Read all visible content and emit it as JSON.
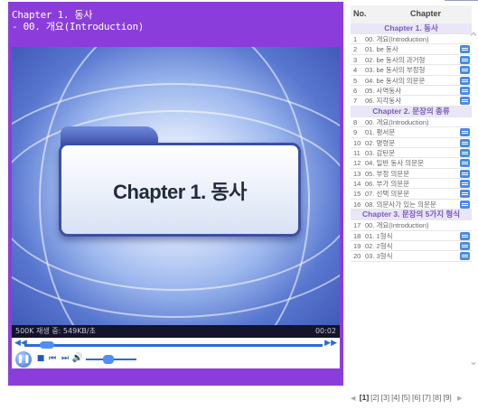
{
  "player": {
    "title_line1": "Chapter 1. 동사",
    "title_line2": "- 00. 개요(Introduction)",
    "slide_text": "Chapter 1. 동사",
    "status_left": "500K 재생 중: 549KB/초",
    "status_right": "00:02",
    "progress": 0.05,
    "volume": 0.45,
    "accent": "#8b3ddb"
  },
  "list": {
    "header_no": "No.",
    "header_chapter": "Chapter",
    "rows": [
      {
        "type": "section",
        "title": "Chapter 1. 동사"
      },
      {
        "type": "item",
        "num": "1",
        "title": "00. 개요(Introduction)",
        "doc": false
      },
      {
        "type": "item",
        "num": "2",
        "title": "01. be 동사",
        "doc": true
      },
      {
        "type": "item",
        "num": "3",
        "title": "02. be 동사의 과거형",
        "doc": true
      },
      {
        "type": "item",
        "num": "4",
        "title": "03. be 동사의 부정형",
        "doc": true
      },
      {
        "type": "item",
        "num": "5",
        "title": "04. be 동사의 의문문",
        "doc": true
      },
      {
        "type": "item",
        "num": "6",
        "title": "05. 사역동사",
        "doc": true
      },
      {
        "type": "item",
        "num": "7",
        "title": "06. 지각동사",
        "doc": true
      },
      {
        "type": "section",
        "title": "Chapter 2. 문장의 종류"
      },
      {
        "type": "item",
        "num": "8",
        "title": "00. 개요(Introduction)",
        "doc": false
      },
      {
        "type": "item",
        "num": "9",
        "title": "01. 평서문",
        "doc": true
      },
      {
        "type": "item",
        "num": "10",
        "title": "02. 명령문",
        "doc": true
      },
      {
        "type": "item",
        "num": "11",
        "title": "03. 감탄문",
        "doc": true
      },
      {
        "type": "item",
        "num": "12",
        "title": "04. 일반 동사 의문문",
        "doc": true
      },
      {
        "type": "item",
        "num": "13",
        "title": "05. 부정 의문문",
        "doc": true
      },
      {
        "type": "item",
        "num": "14",
        "title": "06. 부가 의문문",
        "doc": true
      },
      {
        "type": "item",
        "num": "15",
        "title": "07. 선택 의문문",
        "doc": true
      },
      {
        "type": "item",
        "num": "16",
        "title": "08. 의문사가 있는 의문문",
        "doc": true
      },
      {
        "type": "section",
        "title": "Chapter 3. 문장의 5가지 형식"
      },
      {
        "type": "item",
        "num": "17",
        "title": "00. 개요(Introduction)",
        "doc": false
      },
      {
        "type": "item",
        "num": "18",
        "title": "01. 1형식",
        "doc": true
      },
      {
        "type": "item",
        "num": "19",
        "title": "02. 2형식",
        "doc": true
      },
      {
        "type": "item",
        "num": "20",
        "title": "03. 3형식",
        "doc": true
      }
    ]
  },
  "pager": {
    "pages": [
      "[1]",
      "[2]",
      "[3]",
      "[4]",
      "[5]",
      "[6]",
      "[7]",
      "[8]",
      "[9]"
    ],
    "current": "[1]"
  }
}
